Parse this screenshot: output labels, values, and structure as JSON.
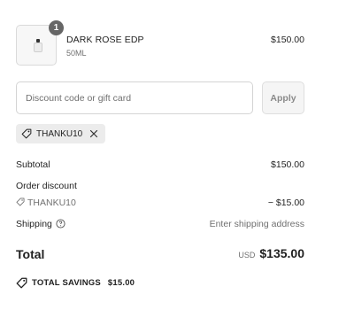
{
  "product": {
    "quantity": "1",
    "name": "DARK ROSE EDP",
    "variant": "50ML",
    "price": "$150.00",
    "thumbnail_icon": "perfume-bottle-icon"
  },
  "discount": {
    "placeholder": "Discount code or gift card",
    "value": "",
    "apply_label": "Apply"
  },
  "applied_code": {
    "code": "THANKU10",
    "tag_icon": "tag-icon",
    "remove_icon": "close-icon"
  },
  "summary": {
    "subtotal_label": "Subtotal",
    "subtotal_value": "$150.00",
    "order_discount_label": "Order discount",
    "discount_code": "THANKU10",
    "discount_value": "− $15.00",
    "shipping_label": "Shipping",
    "shipping_value": "Enter shipping address",
    "shipping_info_icon": "help-circle-icon"
  },
  "total": {
    "label": "Total",
    "currency": "USD",
    "amount": "$135.00"
  },
  "savings": {
    "label": "TOTAL SAVINGS",
    "amount": "$15.00",
    "icon": "tag-icon"
  },
  "colors": {
    "text": "#1f1f1f",
    "muted": "#707070",
    "badge": "#666666",
    "chip_bg": "#ececec",
    "border": "#d4d4d4"
  }
}
